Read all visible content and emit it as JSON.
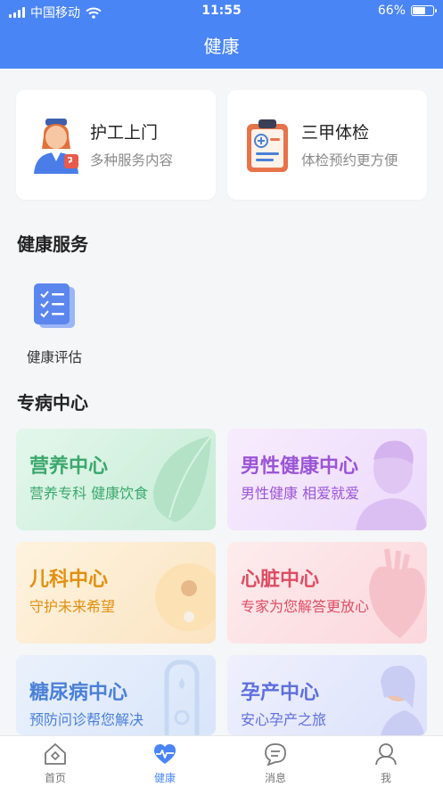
{
  "status_bar": {
    "carrier": "中国移动",
    "time": "11:55",
    "battery": "66%",
    "battery_level": 0.66
  },
  "header": {
    "title": "健康"
  },
  "quick_entries": [
    {
      "title": "护工上门",
      "subtitle": "多种服务内容",
      "icon": "nurse-icon"
    },
    {
      "title": "三甲体检",
      "subtitle": "体检预约更方便",
      "icon": "clipboard-icon"
    }
  ],
  "health_services": {
    "heading": "健康服务",
    "items": [
      {
        "label": "健康评估",
        "icon": "checklist-icon"
      }
    ]
  },
  "disease_centers": {
    "heading": "专病中心",
    "items": [
      {
        "title": "营养中心",
        "subtitle": "营养专科 健康饮食",
        "color": "#3ba86d",
        "bg": "#d8f3e3",
        "icon": "leaf-icon"
      },
      {
        "title": "男性健康中心",
        "subtitle": "男性健康 相爱就爱",
        "color": "#9b55d6",
        "bg": "#f3e4fc",
        "icon": "man-portrait-icon"
      },
      {
        "title": "儿科中心",
        "subtitle": "守护未来希望",
        "color": "#e2900f",
        "bg": "#fdefd8",
        "icon": "baby-icon"
      },
      {
        "title": "心脏中心",
        "subtitle": "专家为您解答更放心",
        "color": "#dc4e63",
        "bg": "#fce3e6",
        "icon": "heart-icon"
      },
      {
        "title": "糖尿病中心",
        "subtitle": "预防问诊帮您解决",
        "color": "#4a80d8",
        "bg": "#e2ecfb",
        "icon": "insulin-device-icon"
      },
      {
        "title": "孕产中心",
        "subtitle": "安心孕产之旅",
        "color": "#5e6fdc",
        "bg": "#e6e9fc",
        "icon": "pregnant-woman-icon"
      }
    ]
  },
  "tab_bar": {
    "items": [
      {
        "label": "首页",
        "icon": "home-icon",
        "active": false
      },
      {
        "label": "健康",
        "icon": "heartbeat-icon",
        "active": true
      },
      {
        "label": "消息",
        "icon": "message-icon",
        "active": false
      },
      {
        "label": "我",
        "icon": "profile-icon",
        "active": false
      }
    ]
  }
}
